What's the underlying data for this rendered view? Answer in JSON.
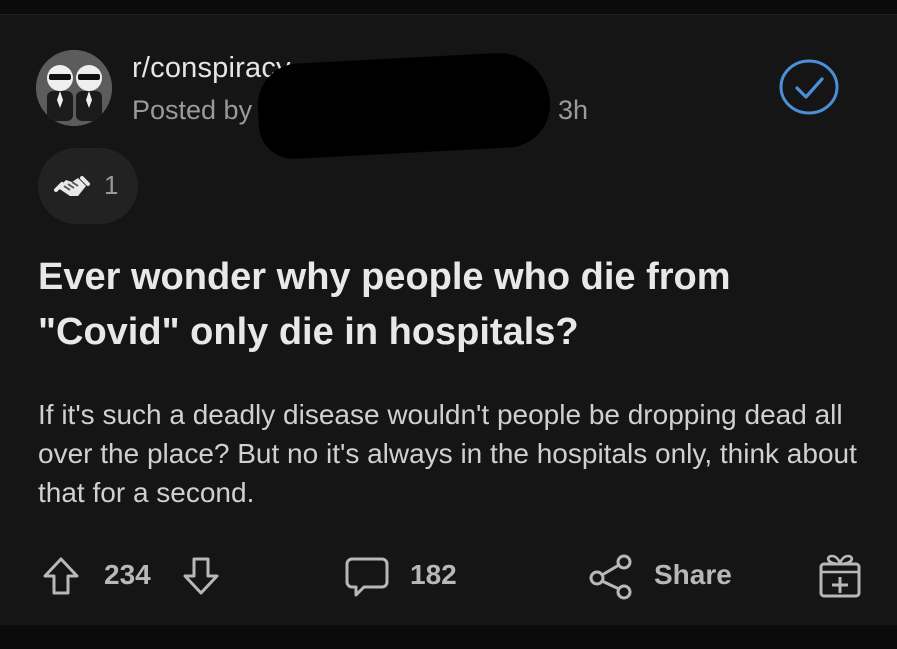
{
  "post": {
    "subreddit": "r/conspiracy",
    "posted_by_label": "Posted by",
    "time_ago": "3h",
    "award_count": "1",
    "title": "Ever wonder why people who die from \"Covid\" only die in hospitals?",
    "body": "If it's such a deadly disease wouldn't people be dropping dead all over the place? But no it's always in the hospitals only, think about that for a second."
  },
  "actions": {
    "score": "234",
    "comments": "182",
    "share_label": "Share"
  },
  "colors": {
    "background": "#151515",
    "verified_accent": "#4a90d9",
    "muted_text": "#9a9a9a"
  }
}
